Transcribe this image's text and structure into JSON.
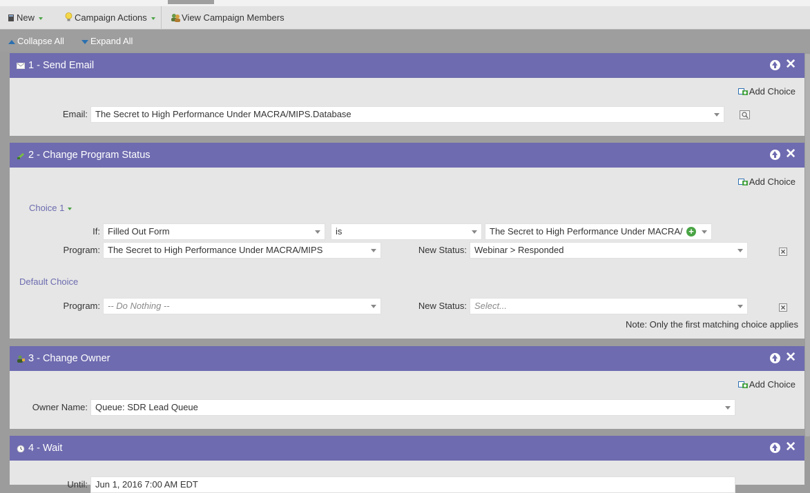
{
  "toolbar": {
    "new_label": "New",
    "campaign_actions_label": "Campaign Actions",
    "view_members_label": "View Campaign Members"
  },
  "subbar": {
    "collapse_label": "Collapse All",
    "expand_label": "Expand All"
  },
  "steps": [
    {
      "title": "1 - Send Email",
      "add_choice": "Add Choice",
      "email_label": "Email:",
      "email_value": "The Secret to High Performance Under MACRA/MIPS.Database"
    },
    {
      "title": "2 - Change Program Status",
      "add_choice": "Add Choice",
      "choice1_label": "Choice 1",
      "if_label": "If:",
      "if_field": "Filled Out Form",
      "if_operator": "is",
      "if_value": "The Secret to High Performance Under MACRA/",
      "program_label": "Program:",
      "program_value": "The Secret to High Performance Under MACRA/MIPS",
      "new_status_label": "New Status:",
      "new_status_value": "Webinar > Responded",
      "default_choice_label": "Default Choice",
      "default_program_label": "Program:",
      "default_program_placeholder": "-- Do Nothing --",
      "default_status_label": "New Status:",
      "default_status_placeholder": "Select...",
      "note": "Note: Only the first matching choice applies"
    },
    {
      "title": "3 - Change Owner",
      "add_choice": "Add Choice",
      "owner_label": "Owner Name:",
      "owner_value": "Queue: SDR Lead Queue"
    },
    {
      "title": "4 - Wait",
      "until_label": "Until:",
      "until_value": "Jun 1, 2016 7:00 AM EDT"
    }
  ],
  "colors": {
    "header_purple": "#6e6bb0",
    "body_gray": "#e6e6e6",
    "accent_green": "#49a444",
    "accent_blue": "#2a6fb0"
  }
}
